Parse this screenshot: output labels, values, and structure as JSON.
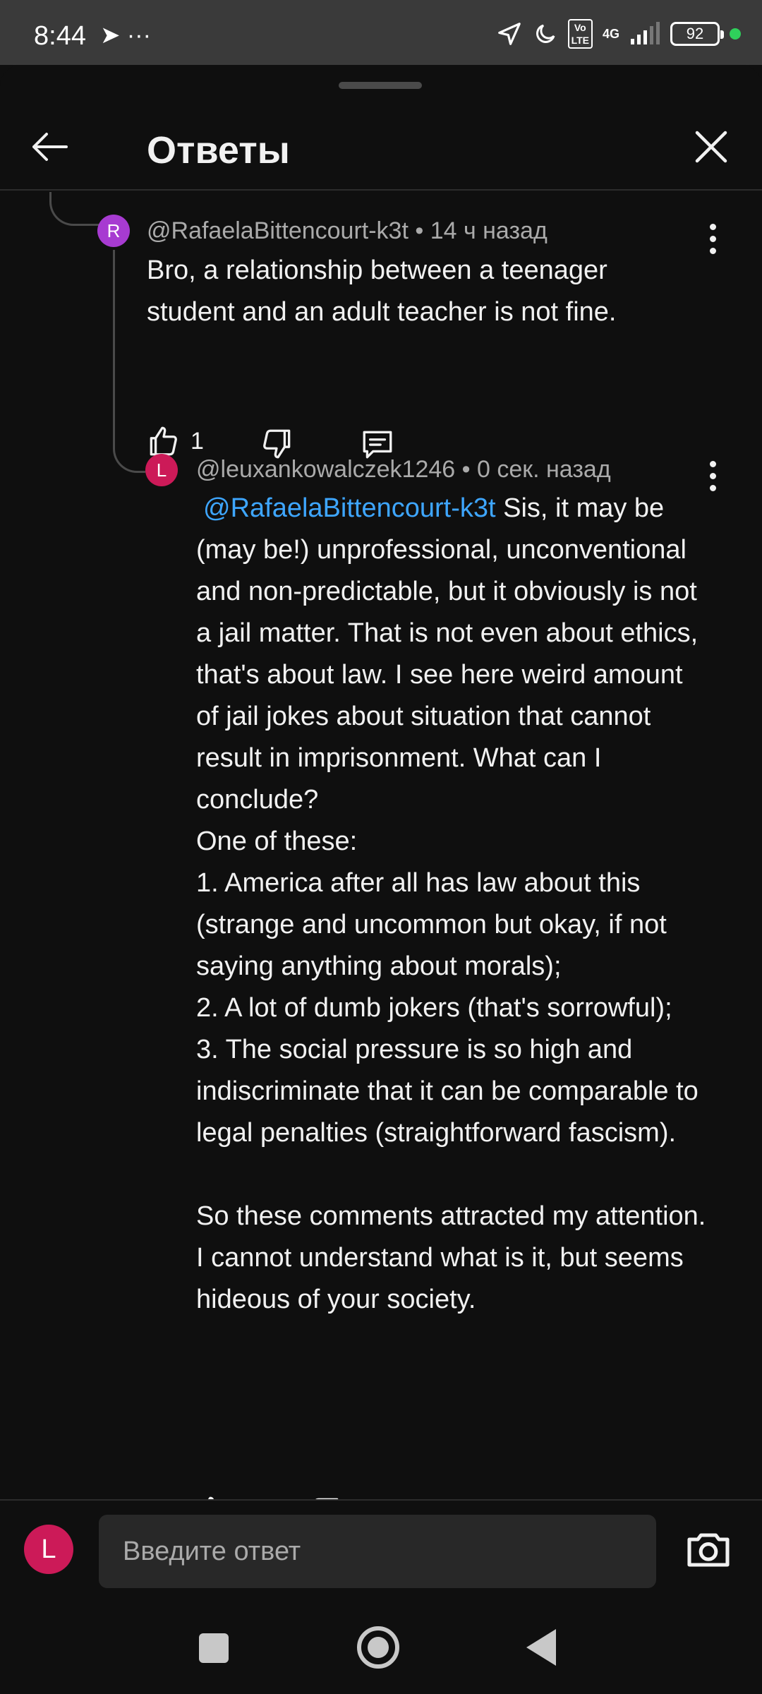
{
  "status_bar": {
    "time": "8:44",
    "left_icons": "➤ ···",
    "network_volte": "Vo\nLTE",
    "network_type": "4G",
    "battery": "92"
  },
  "header": {
    "title": "Ответы"
  },
  "comments": [
    {
      "avatar_letter": "R",
      "avatar_color": "#a73bd1",
      "author": "@RafaelaBittencourt-k3t",
      "time": "14 ч назад",
      "text": "Bro, a relationship between a teenager student and an adult teacher is not fine.",
      "likes": "1"
    },
    {
      "avatar_letter": "L",
      "avatar_color": "#cc1a58",
      "author": "@leuxankowalczek1246",
      "time": "0 сек. назад",
      "mention": "@RafaelaBittencourt-k3t",
      "text_lines": [
        " Sis, it may be (may be!) unprofessional, unconventional and non-predictable, but it obviously is not a jail matter. That is not even about ethics, that's about law. I see here weird amount of jail jokes about situation that cannot result in imprisonment. What can I conclude?",
        "One of these:",
        "1. America after all has law about this (strange and uncommon but okay, if not saying anything about morals);",
        "2. A lot of dumb jokers (that's sorrowful);",
        "3. The social pressure is so high and indiscriminate that it can be comparable to legal penalties (straightforward fascism).",
        "",
        "So these comments attracted my attention. I cannot understand what is it, but seems hideous of your society."
      ],
      "likes": ""
    }
  ],
  "reply_bar": {
    "avatar_letter": "L",
    "avatar_color": "#cc1a58",
    "placeholder": "Введите ответ"
  },
  "icons": [
    "back-arrow-icon",
    "close-icon",
    "like-icon",
    "dislike-icon",
    "reply-icon",
    "more-vert-icon",
    "camera-icon"
  ]
}
